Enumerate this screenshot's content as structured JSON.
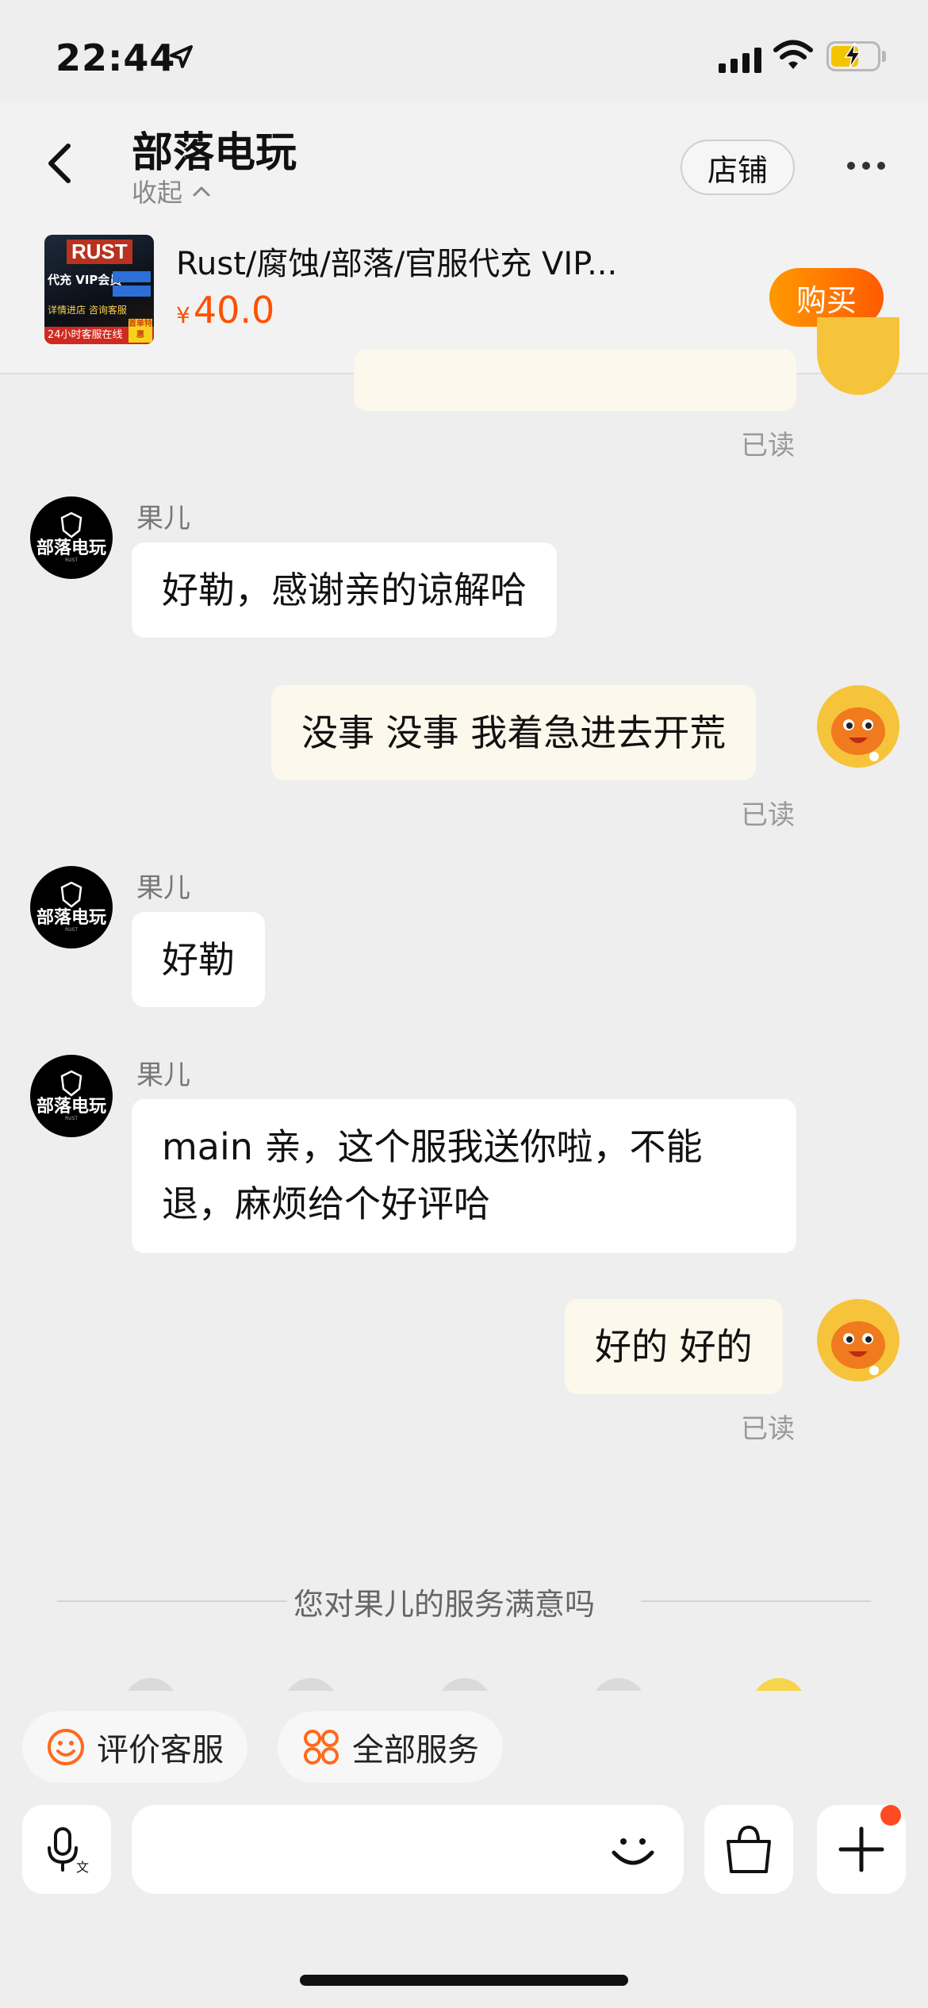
{
  "status_bar": {
    "time": "22:44"
  },
  "header": {
    "shop_name": "部落电玩",
    "collapse_label": "收起",
    "store_button": "店铺"
  },
  "product": {
    "title": "Rust/腐蚀/部落/官服代充 VIP...",
    "currency": "¥",
    "price": "40.0",
    "buy_button": "购买",
    "image_text": {
      "brand": "RUST",
      "side": "代充 VIP会员",
      "side2": "详情进店 咨询客服",
      "bar": "24小时客服在线",
      "badge": "首单特惠"
    }
  },
  "messages": {
    "read_label": "已读",
    "shop_avatar": {
      "name": "部落电玩",
      "sub": "RUST"
    },
    "m1": {
      "sender": "果儿",
      "text": "好勒，感谢亲的谅解哈"
    },
    "m2": {
      "text": "没事 没事 我着急进去开荒"
    },
    "m3": {
      "sender": "果儿",
      "text": "好勒"
    },
    "m4": {
      "sender": "果儿",
      "line1": "main 亲，这个服我送你啦，不能",
      "line2": "退，麻烦给个好评哈"
    },
    "m5": {
      "text": "好的 好的"
    }
  },
  "rating": {
    "prompt": "您对果儿的服务满意吗"
  },
  "quick_actions": {
    "rate_agent": "评价客服",
    "all_services": "全部服务"
  },
  "colors": {
    "accent": "#ff5000",
    "buy_gradient_start": "#ff9a00",
    "outgoing_bubble": "#fcf8ec",
    "notification": "#ff4a22"
  }
}
